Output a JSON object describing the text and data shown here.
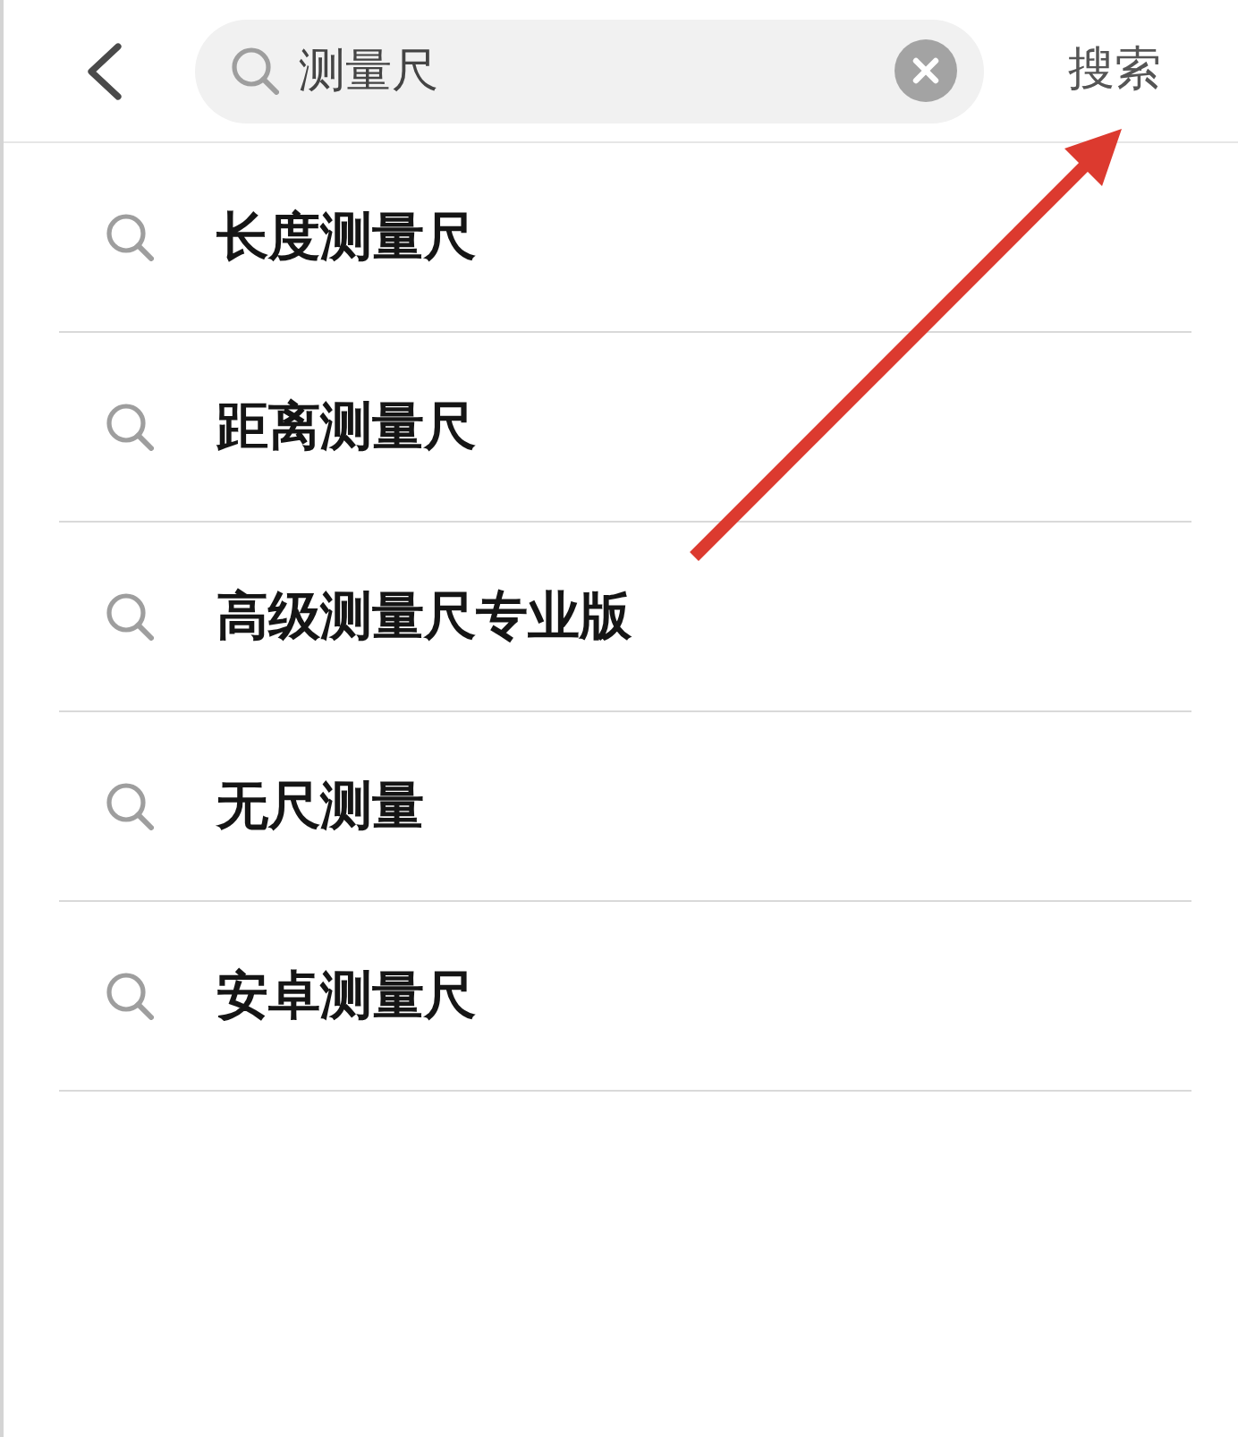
{
  "header": {
    "search": {
      "value": "测量尺"
    },
    "action": "搜索"
  },
  "suggestions": [
    {
      "text": "长度测量尺"
    },
    {
      "text": "距离测量尺"
    },
    {
      "text": "高级测量尺专业版"
    },
    {
      "text": "无尺测量"
    },
    {
      "text": "安卓测量尺"
    }
  ]
}
